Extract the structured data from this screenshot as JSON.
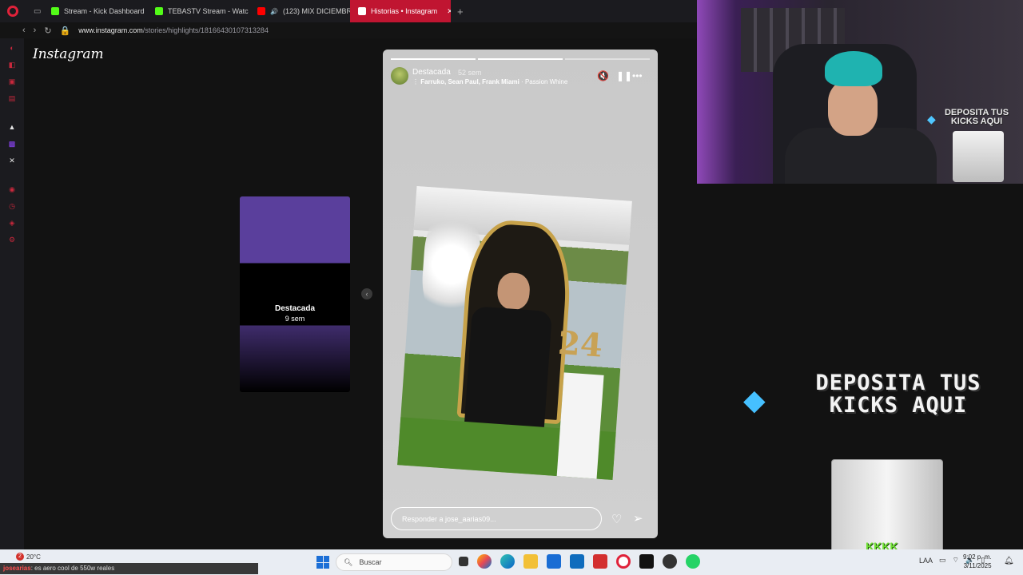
{
  "browser": {
    "tabs": [
      {
        "label": "Stream - Kick Dashboard",
        "icon": "kick-icon",
        "color": "#53fc18"
      },
      {
        "label": "TEBASTV Stream - Watc",
        "icon": "kick-icon",
        "color": "#53fc18"
      },
      {
        "label": "(123) MIX DICIEMBRE",
        "icon": "youtube-icon",
        "color": "#ff0000"
      },
      {
        "label": "Historias • Instagram",
        "icon": "instagram-icon",
        "color": "#e1306c"
      }
    ],
    "url_domain": "www.instagram.com",
    "url_path": "/stories/highlights/18166430107313284"
  },
  "instagram": {
    "logo": "Instagram",
    "side_card": {
      "title": "Destacada",
      "time": "9 sem"
    },
    "story": {
      "username": "Destacada",
      "time": "52 sem",
      "artists": "Farruko, Sean Paul, Frank Miami",
      "song": "Passion Whine",
      "number_on_photo": "24",
      "reply_placeholder": "Responder a jose_aarias09...",
      "progress_total": 3,
      "progress_completed": 2
    }
  },
  "overlay": {
    "promo_line1": "DEPOSITA TUS",
    "promo_line2": "KICKS AQUI",
    "glass_logo": "KKKK"
  },
  "taskbar": {
    "weather_temp": "20°C",
    "weather_badge": "2",
    "ticker_user": "josearias",
    "ticker_text": ": es aero cool de 550w reales",
    "search_placeholder": "Buscar",
    "lang": "LAA",
    "time": "9:02 p. m.",
    "date": "3/11/2025"
  },
  "colors": {
    "accent": "#c01531",
    "instagram_bg": "#121212",
    "story_purple": "#5a3f9c"
  }
}
